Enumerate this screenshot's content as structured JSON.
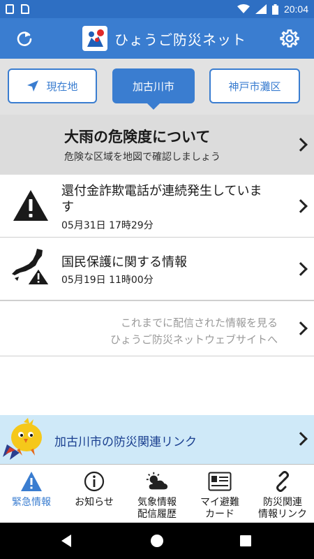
{
  "status_bar": {
    "time": "20:04"
  },
  "app_bar": {
    "title": "ひょうご防災ネット"
  },
  "locations": {
    "current": "現在地",
    "selected": "加古川市",
    "other": "神戸市灘区"
  },
  "risk_banner": {
    "title": "大雨の危険度について",
    "subtitle": "危険な区域を地図で確認しましょう"
  },
  "notices": [
    {
      "title": "還付金詐欺電話が連続発生しています",
      "time": "05月31日 17時29分",
      "icon": "warning-triangle-icon"
    },
    {
      "title": "国民保護に関する情報",
      "time": "05月19日 11時00分",
      "icon": "japan-map-warning-icon"
    }
  ],
  "more": {
    "line1": "これまでに配信された情報を見る",
    "line2": "ひょうご防災ネットウェブサイトへ"
  },
  "link_banner": {
    "label": "加古川市の防災関連リンク"
  },
  "bottom_nav": [
    {
      "label": "緊急情報",
      "icon": "alert-triangle-icon",
      "active": true
    },
    {
      "label": "お知らせ",
      "icon": "info-circle-icon",
      "active": false
    },
    {
      "label": "気象情報\n配信履歴",
      "icon": "weather-icon",
      "active": false
    },
    {
      "label": "マイ避難\nカード",
      "icon": "card-icon",
      "active": false
    },
    {
      "label": "防災関連\n情報リンク",
      "icon": "link-icon",
      "active": false
    }
  ],
  "colors": {
    "primary": "#3a7dd0",
    "status_bar": "#2e6fc3",
    "banner_gray": "#dcdcdc",
    "link_banner": "#cfe9f8"
  }
}
